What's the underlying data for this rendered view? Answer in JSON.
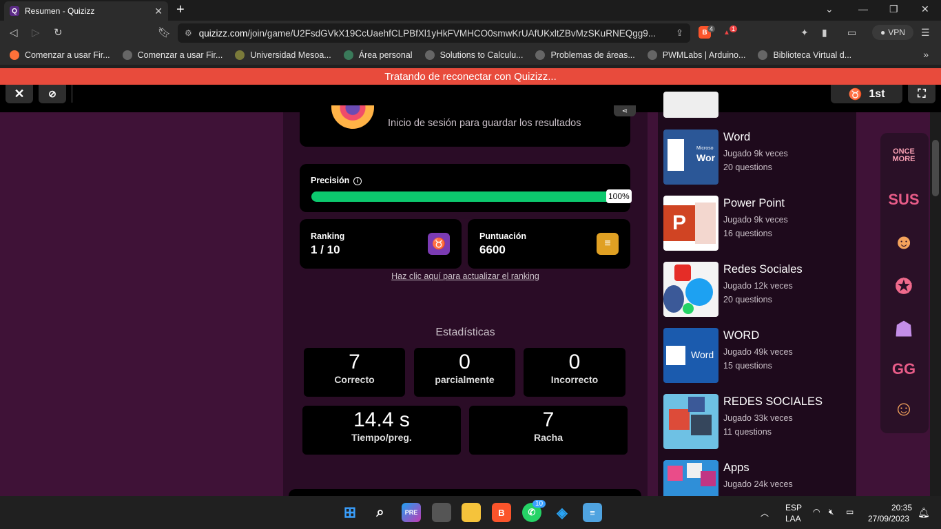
{
  "browser": {
    "tab_title": "Resumen - Quizizz",
    "url_host": "quizizz.com",
    "url_path": "/join/game/U2FsdGVkX19CcUaehfCLPBfXl1yHkFVMHCO0smwKrUAfUKxltZBvMzSKuRNEQgg9...",
    "brave_count": "4",
    "alerts_count": "1",
    "vpn_label": "VPN"
  },
  "bookmarks": [
    "Comenzar a usar Fir...",
    "Comenzar a usar Fir...",
    "Universidad Mesoa...",
    "Área personal",
    "Solutions to Calculu...",
    "Problemas de áreas...",
    "PWMLabs | Arduino...",
    "Biblioteca Virtual d..."
  ],
  "banner": "Tratando de reconectar con Quizizz...",
  "topbar": {
    "rank_label": "1st"
  },
  "summary": {
    "login_text": "Inicio de sesión para guardar los resultados",
    "accuracy_label": "Precisión",
    "accuracy_value": "100%",
    "accuracy_fraction": 1.0,
    "ranking_label": "Ranking",
    "ranking_value": "1 / 10",
    "score_label": "Puntuación",
    "score_value": "6600",
    "refresh_link": "Haz clic aquí para actualizar el ranking",
    "stats_title": "Estadísticas",
    "stats": [
      {
        "value": "7",
        "label": "Correcto"
      },
      {
        "value": "0",
        "label": "parcialmente"
      },
      {
        "value": "0",
        "label": "Incorrecto"
      },
      {
        "value": "14.4 s",
        "label": "Tiempo/preg."
      },
      {
        "value": "7",
        "label": "Racha"
      }
    ]
  },
  "quizzes": [
    {
      "title": "Word",
      "plays": "Jugado 9k veces",
      "questions": "20 questions",
      "thumb_text": "Wor",
      "thumb_small": "Microso"
    },
    {
      "title": "Power Point",
      "plays": "Jugado 9k veces",
      "questions": "16 questions",
      "thumb_text": "P"
    },
    {
      "title": "Redes Sociales",
      "plays": "Jugado 12k veces",
      "questions": "20 questions"
    },
    {
      "title": "WORD",
      "plays": "Jugado 49k veces",
      "questions": "15 questions",
      "thumb_text": "Word"
    },
    {
      "title": "REDES SOCIALES",
      "plays": "Jugado 33k veces",
      "questions": "11 questions"
    },
    {
      "title": "Apps",
      "plays": "Jugado 24k veces",
      "questions": ""
    }
  ],
  "stickers": [
    "ONCE MORE",
    "SUS"
  ],
  "taskbar": {
    "whatsapp_badge": "10",
    "lang_top": "ESP",
    "lang_bottom": "LAA",
    "time": "20:35",
    "date": "27/09/2023"
  },
  "colors": {
    "banner": "#e84b3c",
    "progress": "#0cc96e",
    "page_bg": "#3f1237",
    "ranking_badge": "#7b3bb3",
    "score_badge": "#e0a023"
  }
}
